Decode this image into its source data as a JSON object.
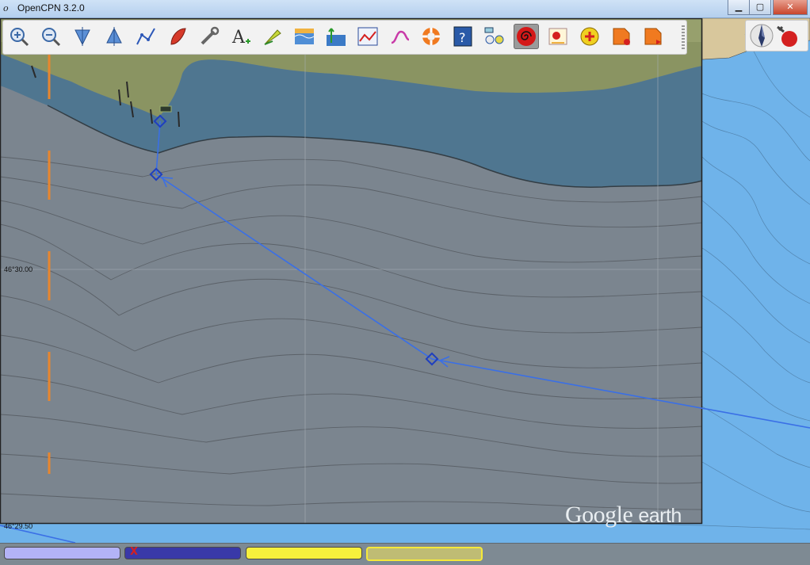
{
  "window": {
    "app_icon": "o",
    "title": "OpenCPN 3.2.0",
    "controls": [
      "minimize",
      "maximize",
      "close"
    ]
  },
  "toolbar": {
    "buttons": [
      {
        "name": "zoom-in",
        "icon": "zoom-in-icon"
      },
      {
        "name": "zoom-out",
        "icon": "zoom-out-icon"
      },
      {
        "name": "scale-in",
        "icon": "scale-in-icon"
      },
      {
        "name": "scale-out",
        "icon": "scale-out-icon"
      },
      {
        "name": "create-route",
        "icon": "route-icon"
      },
      {
        "name": "auto-follow",
        "icon": "boat-icon"
      },
      {
        "name": "settings",
        "icon": "wrench-icon"
      },
      {
        "name": "text",
        "icon": "text-icon"
      },
      {
        "name": "current",
        "icon": "current-icon"
      },
      {
        "name": "tide",
        "icon": "tide-icon"
      },
      {
        "name": "ais-tide",
        "icon": "tide-height-icon"
      },
      {
        "name": "track",
        "icon": "track-icon"
      },
      {
        "name": "route-manager",
        "icon": "route-manager-icon"
      },
      {
        "name": "mob",
        "icon": "lifebuoy-icon"
      },
      {
        "name": "help",
        "icon": "help-icon"
      },
      {
        "name": "layers",
        "icon": "layers-icon"
      },
      {
        "name": "plugin-1",
        "icon": "spiral-icon",
        "active": true
      },
      {
        "name": "plugin-2",
        "icon": "weather-icon"
      },
      {
        "name": "plugin-3",
        "icon": "radar-icon"
      },
      {
        "name": "plugin-4",
        "icon": "record-icon"
      },
      {
        "name": "plugin-5",
        "icon": "play-icon"
      }
    ]
  },
  "compass": {
    "north_icon": "compass-north-icon",
    "gps_icon": "gps-status-icon"
  },
  "chart": {
    "lat_labels": [
      "46°30.00",
      "46°29.50"
    ],
    "watermark_main": "Google",
    "watermark_sub": "earth",
    "colors": {
      "route": "#3a6fe6",
      "water": "#6fb3ea",
      "land": "#d8c79c",
      "overlay": "#7b858f"
    }
  },
  "statusbar": {
    "panels": [
      {
        "color": "#b3b3f7"
      },
      {
        "color": "#3939a8",
        "mark": "X"
      },
      {
        "color": "#f7f03c"
      },
      {
        "color": "#bfbc74",
        "border": "#f5e93a"
      }
    ]
  }
}
